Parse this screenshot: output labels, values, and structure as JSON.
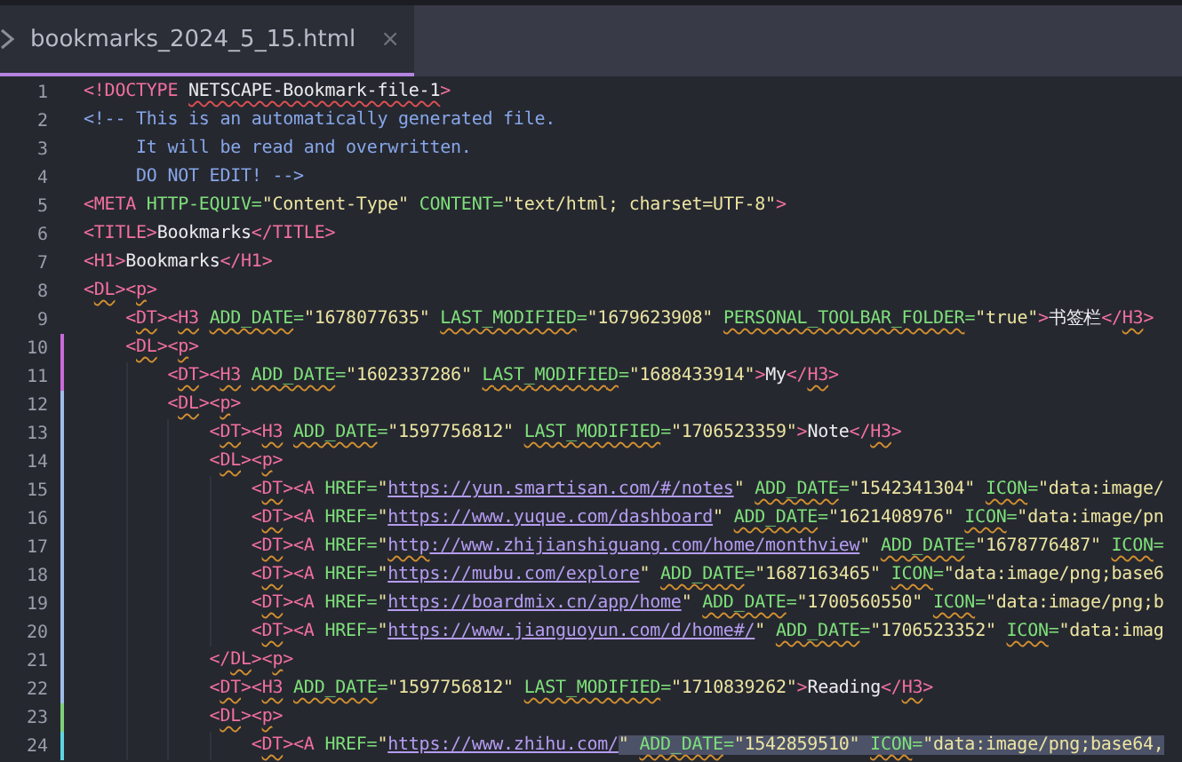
{
  "tab": {
    "title": "bookmarks_2024_5_15.html",
    "close": "×",
    "selected": true
  },
  "lines": [
    {
      "number": "1",
      "tokens": [
        {
          "kind": "punct",
          "text": "<!DOCTYPE"
        },
        {
          "kind": "space"
        },
        {
          "kind": "doctype_error",
          "text": "NETSCAPE-Bookmark-file-1"
        },
        {
          "kind": "punct",
          "text": ">"
        }
      ]
    },
    {
      "number": "2",
      "tokens": [
        {
          "kind": "comment",
          "text": "<!-- This is an automatically generated file."
        }
      ]
    },
    {
      "number": "3",
      "tokens": [
        {
          "kind": "comment",
          "text": "     It will be read and overwritten."
        }
      ]
    },
    {
      "number": "4",
      "tokens": [
        {
          "kind": "comment",
          "text": "     DO NOT EDIT! -->"
        }
      ]
    },
    {
      "number": "5",
      "tokens": [
        {
          "kind": "punct",
          "text": "<META"
        },
        {
          "kind": "space"
        },
        {
          "kind": "attr",
          "text": "HTTP-EQUIV="
        },
        {
          "kind": "string",
          "text": "\"Content-Type\""
        },
        {
          "kind": "space"
        },
        {
          "kind": "attr",
          "text": "CONTENT="
        },
        {
          "kind": "string",
          "text": "\"text/html; charset=UTF-8\""
        },
        {
          "kind": "punct",
          "text": ">"
        }
      ]
    },
    {
      "number": "6",
      "tokens": [
        {
          "kind": "punct",
          "text": "<TITLE>"
        },
        {
          "kind": "text",
          "text": "Bookmarks"
        },
        {
          "kind": "punct",
          "text": "</TITLE>"
        }
      ]
    },
    {
      "number": "7",
      "tokens": [
        {
          "kind": "punct",
          "text": "<H1>"
        },
        {
          "kind": "text",
          "text": "Bookmarks"
        },
        {
          "kind": "punct",
          "text": "</H1>"
        }
      ]
    },
    {
      "number": "8",
      "tokens": [
        {
          "kind": "punct",
          "text": "<"
        },
        {
          "kind": "tag_lint",
          "text": "DL"
        },
        {
          "kind": "punct",
          "text": "><"
        },
        {
          "kind": "tag_lint",
          "text": "p"
        },
        {
          "kind": "punct",
          "text": ">"
        }
      ]
    },
    {
      "number": "9",
      "tokens": [
        {
          "kind": "indent"
        },
        {
          "kind": "punct",
          "text": "<"
        },
        {
          "kind": "tag_lint",
          "text": "DT"
        },
        {
          "kind": "punct",
          "text": "><"
        },
        {
          "kind": "tag_lint",
          "text": "H3"
        },
        {
          "kind": "space"
        },
        {
          "kind": "attr_lint",
          "text": "ADD_DATE"
        },
        {
          "kind": "attr",
          "text": "="
        },
        {
          "kind": "string",
          "text": "\"1678077635\""
        },
        {
          "kind": "space"
        },
        {
          "kind": "attr_lint",
          "text": "LAST_MODIFIED"
        },
        {
          "kind": "attr",
          "text": "="
        },
        {
          "kind": "string",
          "text": "\"1679623908\""
        },
        {
          "kind": "space"
        },
        {
          "kind": "attr_lint",
          "text": "PERSONAL_TOOLBAR_FOLDER"
        },
        {
          "kind": "attr",
          "text": "="
        },
        {
          "kind": "string",
          "text": "\"true\""
        },
        {
          "kind": "punct",
          "text": ">"
        },
        {
          "kind": "text",
          "text": "书签栏"
        },
        {
          "kind": "punct",
          "text": "</"
        },
        {
          "kind": "tag_lint",
          "text": "H3"
        },
        {
          "kind": "punct",
          "text": ">"
        }
      ]
    },
    {
      "number": "10",
      "color": "#c86ad8",
      "tokens": [
        {
          "kind": "indent"
        },
        {
          "kind": "punct",
          "text": "<"
        },
        {
          "kind": "tag_lint",
          "text": "DL"
        },
        {
          "kind": "punct",
          "text": "><"
        },
        {
          "kind": "tag_lint",
          "text": "p"
        },
        {
          "kind": "punct",
          "text": ">"
        }
      ]
    },
    {
      "number": "11",
      "color": "#c86ad8",
      "tokens": [
        {
          "kind": "indent"
        },
        {
          "kind": "indent"
        },
        {
          "kind": "punct",
          "text": "<"
        },
        {
          "kind": "tag_lint",
          "text": "DT"
        },
        {
          "kind": "punct",
          "text": "><"
        },
        {
          "kind": "tag_lint",
          "text": "H3"
        },
        {
          "kind": "space"
        },
        {
          "kind": "attr_lint",
          "text": "ADD_DATE"
        },
        {
          "kind": "attr",
          "text": "="
        },
        {
          "kind": "string",
          "text": "\"1602337286\""
        },
        {
          "kind": "space"
        },
        {
          "kind": "attr_lint",
          "text": "LAST_MODIFIED"
        },
        {
          "kind": "attr",
          "text": "="
        },
        {
          "kind": "string",
          "text": "\"1688433914\""
        },
        {
          "kind": "punct",
          "text": ">"
        },
        {
          "kind": "text",
          "text": "My"
        },
        {
          "kind": "punct",
          "text": "</"
        },
        {
          "kind": "tag_lint",
          "text": "H3"
        },
        {
          "kind": "punct",
          "text": ">"
        }
      ]
    },
    {
      "number": "12",
      "color": "#9fbde6",
      "tokens": [
        {
          "kind": "indent"
        },
        {
          "kind": "indent"
        },
        {
          "kind": "punct",
          "text": "<"
        },
        {
          "kind": "tag_lint",
          "text": "DL"
        },
        {
          "kind": "punct",
          "text": "><"
        },
        {
          "kind": "tag_lint",
          "text": "p"
        },
        {
          "kind": "punct",
          "text": ">"
        }
      ]
    },
    {
      "number": "13",
      "color": "#9fbde6",
      "tokens": [
        {
          "kind": "indent"
        },
        {
          "kind": "indent"
        },
        {
          "kind": "indent"
        },
        {
          "kind": "punct",
          "text": "<"
        },
        {
          "kind": "tag_lint",
          "text": "DT"
        },
        {
          "kind": "punct",
          "text": "><"
        },
        {
          "kind": "tag_lint",
          "text": "H3"
        },
        {
          "kind": "space"
        },
        {
          "kind": "attr_lint",
          "text": "ADD_DATE"
        },
        {
          "kind": "attr",
          "text": "="
        },
        {
          "kind": "string",
          "text": "\"1597756812\""
        },
        {
          "kind": "space"
        },
        {
          "kind": "attr_lint",
          "text": "LAST_MODIFIED"
        },
        {
          "kind": "attr",
          "text": "="
        },
        {
          "kind": "string",
          "text": "\"1706523359\""
        },
        {
          "kind": "punct",
          "text": ">"
        },
        {
          "kind": "text",
          "text": "Note"
        },
        {
          "kind": "punct",
          "text": "</"
        },
        {
          "kind": "tag_lint",
          "text": "H3"
        },
        {
          "kind": "punct",
          "text": ">"
        }
      ]
    },
    {
      "number": "14",
      "color": "#9fbde6",
      "tokens": [
        {
          "kind": "indent"
        },
        {
          "kind": "indent"
        },
        {
          "kind": "indent"
        },
        {
          "kind": "punct",
          "text": "<"
        },
        {
          "kind": "tag_lint",
          "text": "DL"
        },
        {
          "kind": "punct",
          "text": "><"
        },
        {
          "kind": "tag_lint",
          "text": "p"
        },
        {
          "kind": "punct",
          "text": ">"
        }
      ]
    },
    {
      "number": "15",
      "color": "#9fbde6",
      "tokens": [
        {
          "kind": "indent"
        },
        {
          "kind": "indent"
        },
        {
          "kind": "indent"
        },
        {
          "kind": "indent"
        },
        {
          "kind": "punct",
          "text": "<"
        },
        {
          "kind": "tag_lint",
          "text": "DT"
        },
        {
          "kind": "punct",
          "text": "><A"
        },
        {
          "kind": "space"
        },
        {
          "kind": "attr",
          "text": "HREF="
        },
        {
          "kind": "string",
          "text": "\""
        },
        {
          "kind": "link",
          "text": "https://yun.smartisan.com/#/notes"
        },
        {
          "kind": "string",
          "text": "\""
        },
        {
          "kind": "space"
        },
        {
          "kind": "attr_lint",
          "text": "ADD_DATE"
        },
        {
          "kind": "attr",
          "text": "="
        },
        {
          "kind": "string",
          "text": "\"1542341304\""
        },
        {
          "kind": "space"
        },
        {
          "kind": "attr_lint",
          "text": "ICON"
        },
        {
          "kind": "attr",
          "text": "="
        },
        {
          "kind": "string",
          "text": "\"data:image/"
        }
      ]
    },
    {
      "number": "16",
      "color": "#9fbde6",
      "tokens": [
        {
          "kind": "indent"
        },
        {
          "kind": "indent"
        },
        {
          "kind": "indent"
        },
        {
          "kind": "indent"
        },
        {
          "kind": "punct",
          "text": "<"
        },
        {
          "kind": "tag_lint",
          "text": "DT"
        },
        {
          "kind": "punct",
          "text": "><A"
        },
        {
          "kind": "space"
        },
        {
          "kind": "attr",
          "text": "HREF="
        },
        {
          "kind": "string",
          "text": "\""
        },
        {
          "kind": "link",
          "text": "https://www.yuque.com/dashboard"
        },
        {
          "kind": "string",
          "text": "\""
        },
        {
          "kind": "space"
        },
        {
          "kind": "attr_lint",
          "text": "ADD_DATE"
        },
        {
          "kind": "attr",
          "text": "="
        },
        {
          "kind": "string",
          "text": "\"1621408976\""
        },
        {
          "kind": "space"
        },
        {
          "kind": "attr_lint",
          "text": "ICON"
        },
        {
          "kind": "attr",
          "text": "="
        },
        {
          "kind": "string",
          "text": "\"data:image/pn"
        }
      ]
    },
    {
      "number": "17",
      "color": "#9fbde6",
      "tokens": [
        {
          "kind": "indent"
        },
        {
          "kind": "indent"
        },
        {
          "kind": "indent"
        },
        {
          "kind": "indent"
        },
        {
          "kind": "punct",
          "text": "<"
        },
        {
          "kind": "tag_lint",
          "text": "DT"
        },
        {
          "kind": "punct",
          "text": "><A"
        },
        {
          "kind": "space"
        },
        {
          "kind": "attr",
          "text": "HREF="
        },
        {
          "kind": "string",
          "text": "\""
        },
        {
          "kind": "link_lint",
          "text": "http"
        },
        {
          "kind": "link",
          "text": "://www.zhijianshiguang.com/home/monthview"
        },
        {
          "kind": "string",
          "text": "\""
        },
        {
          "kind": "space"
        },
        {
          "kind": "attr_lint",
          "text": "ADD_DATE"
        },
        {
          "kind": "attr",
          "text": "="
        },
        {
          "kind": "string",
          "text": "\"1678776487\""
        },
        {
          "kind": "space"
        },
        {
          "kind": "attr_lint",
          "text": "ICON"
        },
        {
          "kind": "attr",
          "text": "="
        }
      ]
    },
    {
      "number": "18",
      "color": "#9fbde6",
      "tokens": [
        {
          "kind": "indent"
        },
        {
          "kind": "indent"
        },
        {
          "kind": "indent"
        },
        {
          "kind": "indent"
        },
        {
          "kind": "punct",
          "text": "<"
        },
        {
          "kind": "tag_lint",
          "text": "DT"
        },
        {
          "kind": "punct",
          "text": "><A"
        },
        {
          "kind": "space"
        },
        {
          "kind": "attr",
          "text": "HREF="
        },
        {
          "kind": "string",
          "text": "\""
        },
        {
          "kind": "link",
          "text": "https://mubu.com/explore"
        },
        {
          "kind": "string",
          "text": "\""
        },
        {
          "kind": "space"
        },
        {
          "kind": "attr_lint",
          "text": "ADD_DATE"
        },
        {
          "kind": "attr",
          "text": "="
        },
        {
          "kind": "string",
          "text": "\"1687163465\""
        },
        {
          "kind": "space"
        },
        {
          "kind": "attr_lint",
          "text": "ICON"
        },
        {
          "kind": "attr",
          "text": "="
        },
        {
          "kind": "string",
          "text": "\"data:image/png;base6"
        }
      ]
    },
    {
      "number": "19",
      "color": "#9fbde6",
      "tokens": [
        {
          "kind": "indent"
        },
        {
          "kind": "indent"
        },
        {
          "kind": "indent"
        },
        {
          "kind": "indent"
        },
        {
          "kind": "punct",
          "text": "<"
        },
        {
          "kind": "tag_lint",
          "text": "DT"
        },
        {
          "kind": "punct",
          "text": "><A"
        },
        {
          "kind": "space"
        },
        {
          "kind": "attr",
          "text": "HREF="
        },
        {
          "kind": "string",
          "text": "\""
        },
        {
          "kind": "link",
          "text": "https://boardmix.cn/app/home"
        },
        {
          "kind": "string",
          "text": "\""
        },
        {
          "kind": "space"
        },
        {
          "kind": "attr_lint",
          "text": "ADD_DATE"
        },
        {
          "kind": "attr",
          "text": "="
        },
        {
          "kind": "string",
          "text": "\"1700560550\""
        },
        {
          "kind": "space"
        },
        {
          "kind": "attr_lint",
          "text": "ICON"
        },
        {
          "kind": "attr",
          "text": "="
        },
        {
          "kind": "string",
          "text": "\"data:image/png;b"
        }
      ]
    },
    {
      "number": "20",
      "color": "#9fbde6",
      "tokens": [
        {
          "kind": "indent"
        },
        {
          "kind": "indent"
        },
        {
          "kind": "indent"
        },
        {
          "kind": "indent"
        },
        {
          "kind": "punct",
          "text": "<"
        },
        {
          "kind": "tag_lint",
          "text": "DT"
        },
        {
          "kind": "punct",
          "text": "><A"
        },
        {
          "kind": "space"
        },
        {
          "kind": "attr",
          "text": "HREF="
        },
        {
          "kind": "string",
          "text": "\""
        },
        {
          "kind": "link",
          "text": "https://www.jianguoyun.com/d/home#/"
        },
        {
          "kind": "string",
          "text": "\""
        },
        {
          "kind": "space"
        },
        {
          "kind": "attr_lint",
          "text": "ADD_DATE"
        },
        {
          "kind": "attr",
          "text": "="
        },
        {
          "kind": "string",
          "text": "\"1706523352\""
        },
        {
          "kind": "space"
        },
        {
          "kind": "attr_lint",
          "text": "ICON"
        },
        {
          "kind": "attr",
          "text": "="
        },
        {
          "kind": "string",
          "text": "\"data:imag"
        }
      ]
    },
    {
      "number": "21",
      "color": "#9fbde6",
      "tokens": [
        {
          "kind": "indent"
        },
        {
          "kind": "indent"
        },
        {
          "kind": "indent"
        },
        {
          "kind": "punct",
          "text": "</"
        },
        {
          "kind": "tag_lint",
          "text": "DL"
        },
        {
          "kind": "punct",
          "text": "><"
        },
        {
          "kind": "tag_lint",
          "text": "p"
        },
        {
          "kind": "punct",
          "text": ">"
        }
      ]
    },
    {
      "number": "22",
      "color": "#9fbde6",
      "tokens": [
        {
          "kind": "indent"
        },
        {
          "kind": "indent"
        },
        {
          "kind": "indent"
        },
        {
          "kind": "punct",
          "text": "<"
        },
        {
          "kind": "tag_lint",
          "text": "DT"
        },
        {
          "kind": "punct",
          "text": "><"
        },
        {
          "kind": "tag_lint",
          "text": "H3"
        },
        {
          "kind": "space"
        },
        {
          "kind": "attr_lint",
          "text": "ADD_DATE"
        },
        {
          "kind": "attr",
          "text": "="
        },
        {
          "kind": "string",
          "text": "\"1597756812\""
        },
        {
          "kind": "space"
        },
        {
          "kind": "attr_lint",
          "text": "LAST_MODIFIED"
        },
        {
          "kind": "attr",
          "text": "="
        },
        {
          "kind": "string",
          "text": "\"1710839262\""
        },
        {
          "kind": "punct",
          "text": ">"
        },
        {
          "kind": "text",
          "text": "Reading"
        },
        {
          "kind": "punct",
          "text": "</"
        },
        {
          "kind": "tag_lint",
          "text": "H3"
        },
        {
          "kind": "punct",
          "text": ">"
        }
      ]
    },
    {
      "number": "23",
      "color": "#7fd07a",
      "tokens": [
        {
          "kind": "indent"
        },
        {
          "kind": "indent"
        },
        {
          "kind": "indent"
        },
        {
          "kind": "punct",
          "text": "<"
        },
        {
          "kind": "tag_lint",
          "text": "DL"
        },
        {
          "kind": "punct",
          "text": "><"
        },
        {
          "kind": "tag_lint",
          "text": "p"
        },
        {
          "kind": "punct",
          "text": ">"
        }
      ]
    },
    {
      "number": "24",
      "color": "#5fd3e0",
      "tokens": [
        {
          "kind": "indent"
        },
        {
          "kind": "indent"
        },
        {
          "kind": "indent"
        },
        {
          "kind": "indent"
        },
        {
          "kind": "punct",
          "text": "<"
        },
        {
          "kind": "tag_lint",
          "text": "DT"
        },
        {
          "kind": "punct",
          "text": "><A"
        },
        {
          "kind": "space"
        },
        {
          "kind": "attr",
          "text": "HREF="
        },
        {
          "kind": "string",
          "text": "\""
        },
        {
          "kind": "link",
          "text": "https://www.zhihu.com/"
        }
      ],
      "selected_tokens": [
        {
          "kind": "string",
          "text": "\""
        },
        {
          "kind": "space"
        },
        {
          "kind": "attr_lint",
          "text": "ADD_DATE"
        },
        {
          "kind": "attr",
          "text": "="
        },
        {
          "kind": "string",
          "text": "\"1542859510\""
        },
        {
          "kind": "space"
        },
        {
          "kind": "attr_lint",
          "text": "ICON"
        },
        {
          "kind": "attr",
          "text": "="
        },
        {
          "kind": "string",
          "text": "\"data:image/png;base64,"
        }
      ]
    }
  ]
}
